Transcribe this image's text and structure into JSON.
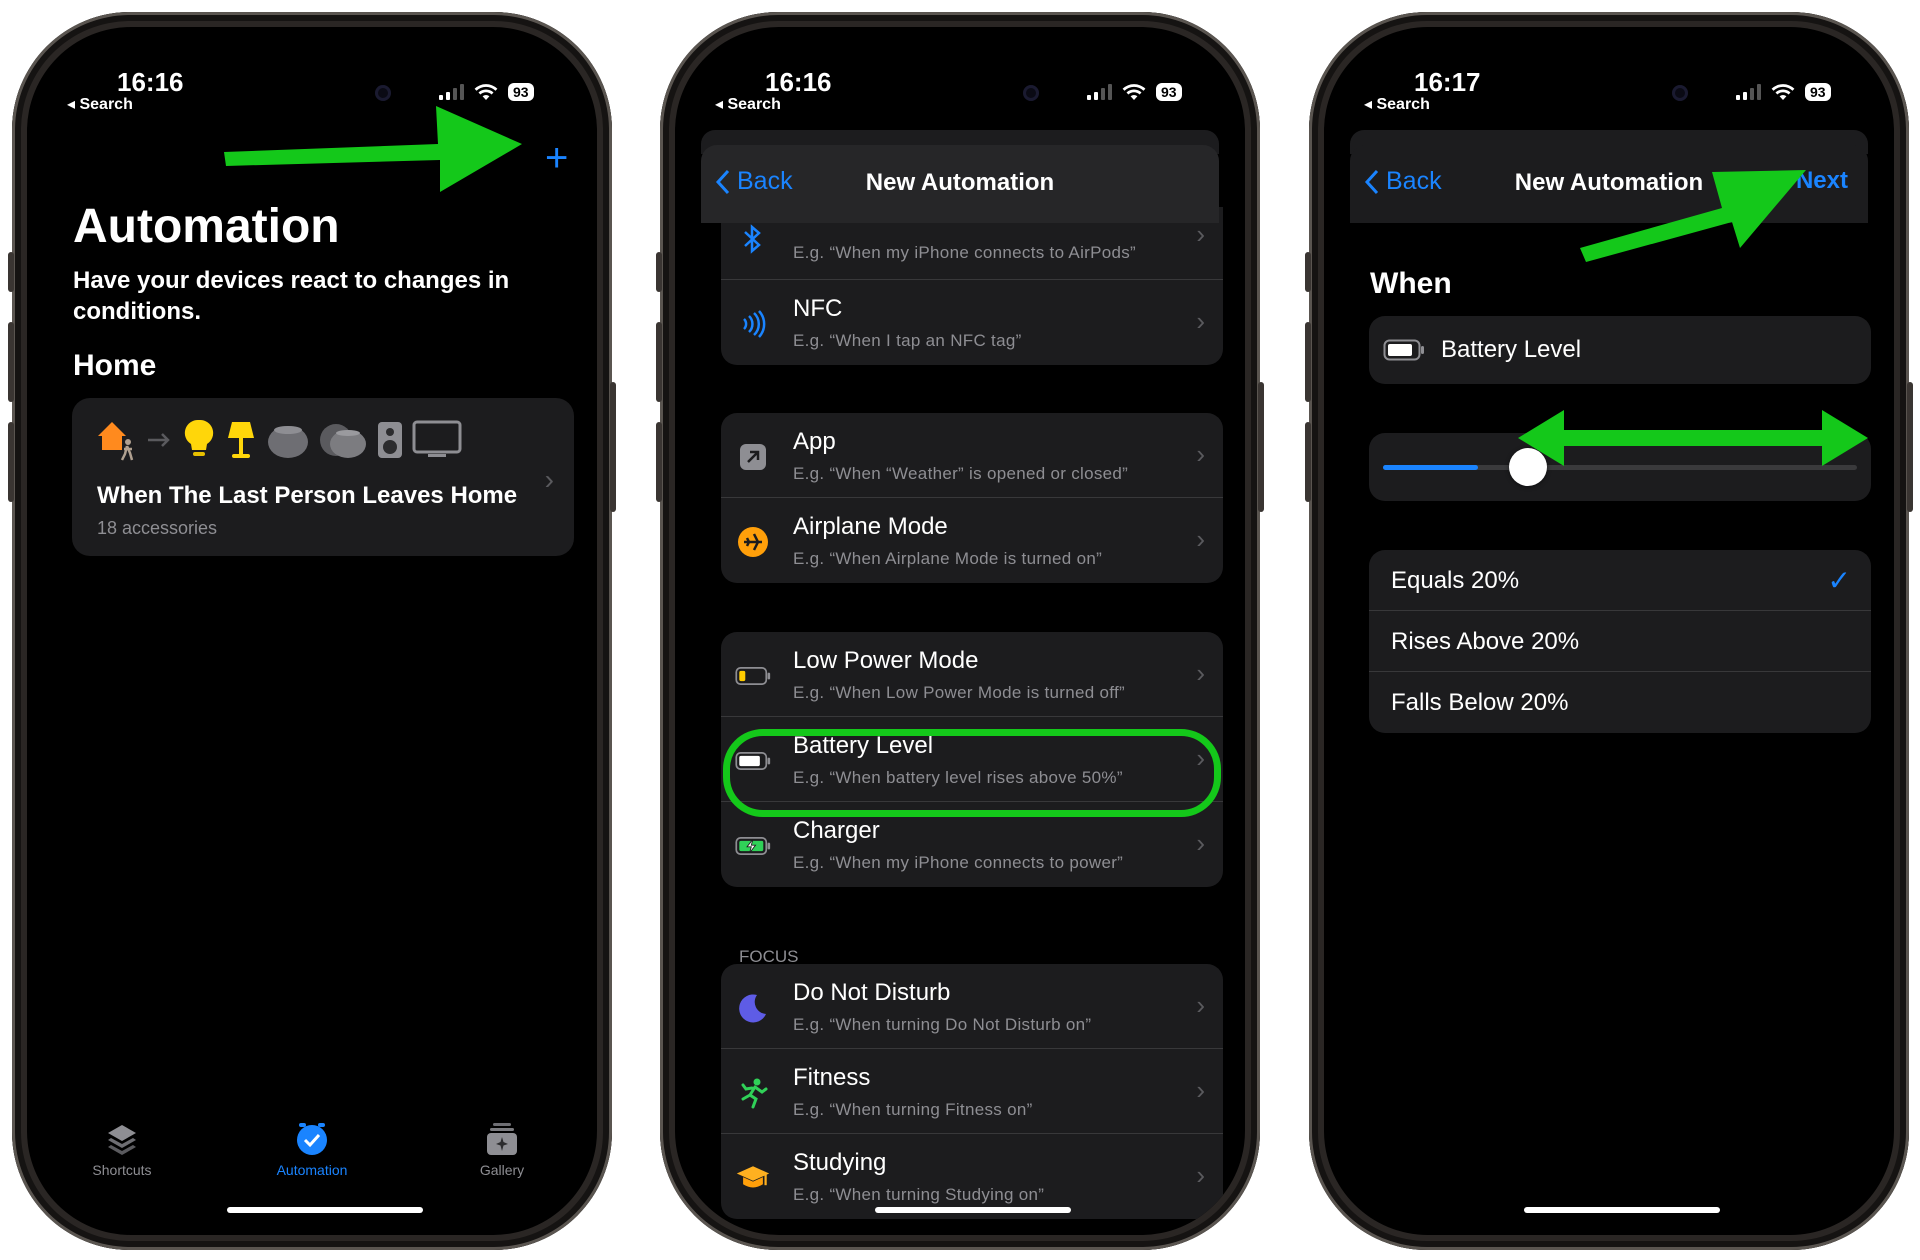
{
  "status": {
    "times": [
      "16:16",
      "16:16",
      "16:17"
    ],
    "back_label": "◂ Search",
    "battery": "93"
  },
  "screen1": {
    "add_symbol": "+",
    "title": "Automation",
    "subtitle": "Have your devices react to changes in conditions.",
    "section": "Home",
    "card": {
      "title": "When The Last Person Leaves Home",
      "subtitle": "18 accessories"
    },
    "tabs": [
      {
        "label": "Shortcuts",
        "icon": "layers-icon"
      },
      {
        "label": "Automation",
        "icon": "clock-check-icon"
      },
      {
        "label": "Gallery",
        "icon": "gallery-icon"
      }
    ]
  },
  "screen2": {
    "back_label": "Back",
    "title": "New Automation",
    "groups": [
      [
        {
          "title": "Bluetooth",
          "sub": "E.g. “When my iPhone connects to AirPods”",
          "icon": "bluetooth-icon"
        },
        {
          "title": "NFC",
          "sub": "E.g. “When I tap an NFC tag”",
          "icon": "nfc-icon"
        }
      ],
      [
        {
          "title": "App",
          "sub": "E.g. “When “Weather” is opened or closed”",
          "icon": "app-icon"
        },
        {
          "title": "Airplane Mode",
          "sub": "E.g. “When Airplane Mode is turned on”",
          "icon": "airplane-icon"
        }
      ],
      [
        {
          "title": "Low Power Mode",
          "sub": "E.g. “When Low Power Mode is turned off”",
          "icon": "low-battery-icon"
        },
        {
          "title": "Battery Level",
          "sub": "E.g. “When battery level rises above 50%”",
          "icon": "battery-icon"
        },
        {
          "title": "Charger",
          "sub": "E.g. “When my iPhone connects to power”",
          "icon": "charging-icon"
        }
      ]
    ],
    "focus_label": "FOCUS",
    "focus_rows": [
      {
        "title": "Do Not Disturb",
        "sub": "E.g. “When turning Do Not Disturb on”",
        "icon": "moon-icon"
      },
      {
        "title": "Fitness",
        "sub": "E.g. “When turning Fitness on”",
        "icon": "runner-icon"
      },
      {
        "title": "Studying",
        "sub": "E.g. “When turning Studying on”",
        "icon": "graduation-cap-icon"
      }
    ]
  },
  "screen3": {
    "back_label": "Back",
    "title": "New Automation",
    "next_label": "Next",
    "when_label": "When",
    "trigger_label": "Battery Level",
    "slider_value": 0.2,
    "options": [
      {
        "label": "Equals 20%",
        "selected": true
      },
      {
        "label": "Rises Above 20%",
        "selected": false
      },
      {
        "label": "Falls Below 20%",
        "selected": false
      }
    ],
    "check_symbol": "✓"
  },
  "colors": {
    "accent": "#1a84ff",
    "annotation_green": "#14c81a",
    "card": "#1c1c1e"
  }
}
